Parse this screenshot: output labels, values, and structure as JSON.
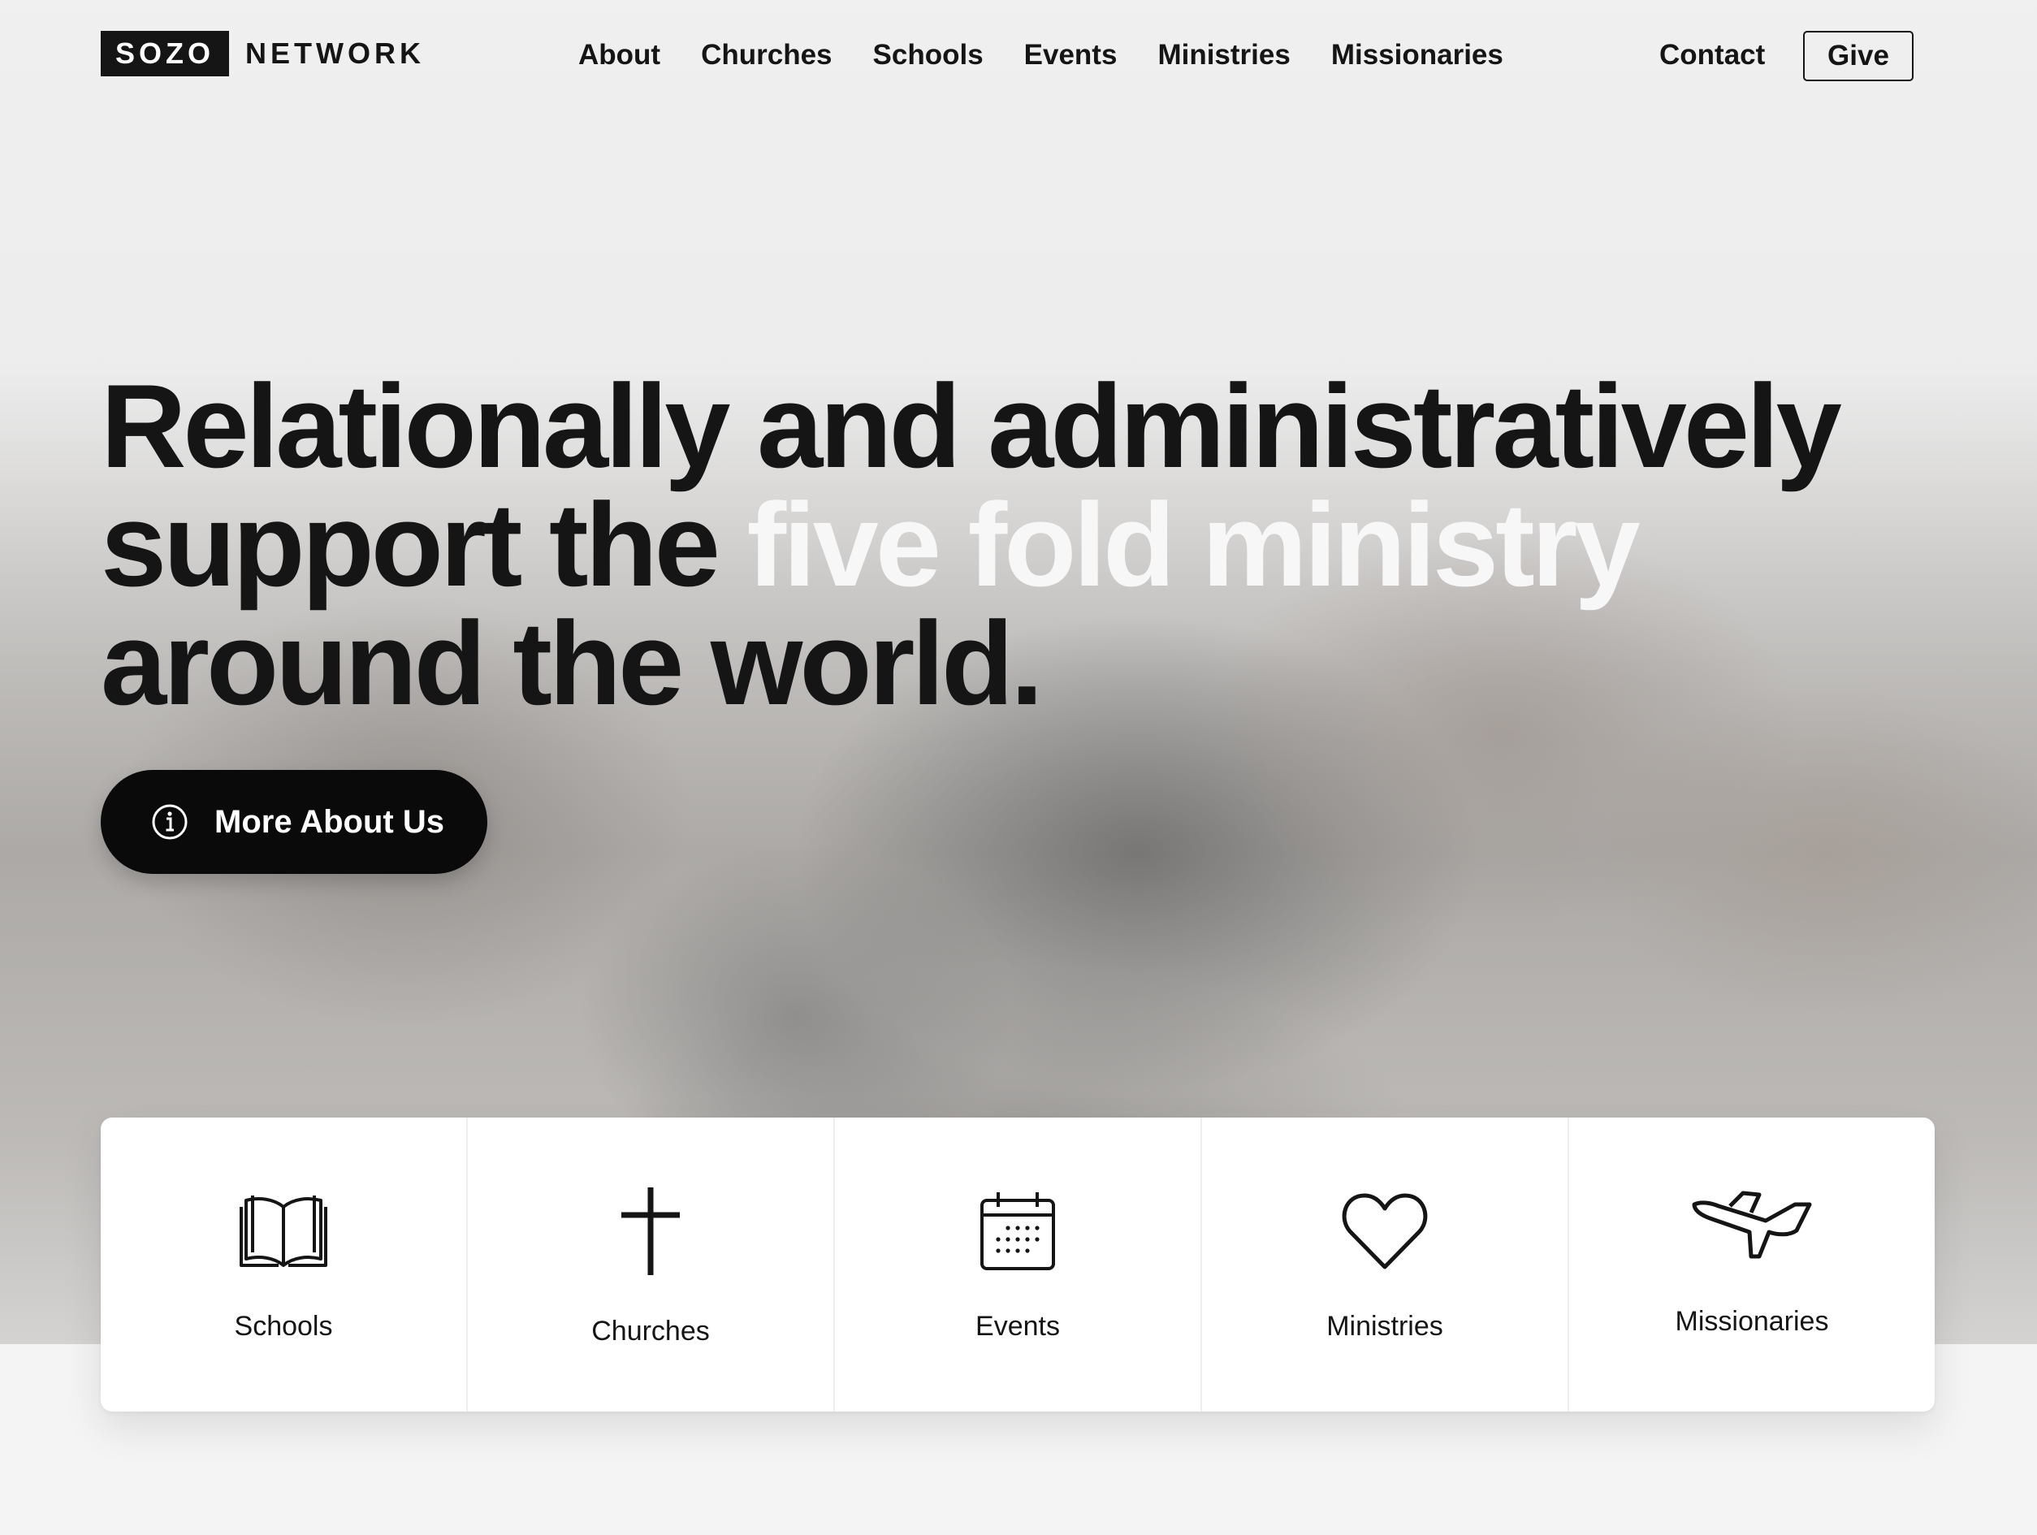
{
  "header": {
    "logo_box": "SOZO",
    "logo_word": "NETWORK",
    "nav": [
      "About",
      "Churches",
      "Schools",
      "Events",
      "Ministries",
      "Missionaries"
    ],
    "contact": "Contact",
    "give": "Give"
  },
  "hero": {
    "line1": "Relationally and administratively",
    "line2_start": "support the ",
    "line2_highlight": "five fold ministry",
    "line3": "around the world.",
    "cta_label": "More About Us"
  },
  "quick_links": [
    {
      "label": "Schools",
      "icon": "open-book-icon"
    },
    {
      "label": "Churches",
      "icon": "cross-icon"
    },
    {
      "label": "Events",
      "icon": "calendar-icon"
    },
    {
      "label": "Ministries",
      "icon": "heart-icon"
    },
    {
      "label": "Missionaries",
      "icon": "airplane-icon"
    }
  ],
  "colors": {
    "text": "#151515",
    "headline_highlight": "#f7f7f7",
    "cta_background": "#0a0a0a",
    "card_background": "#ffffff"
  }
}
